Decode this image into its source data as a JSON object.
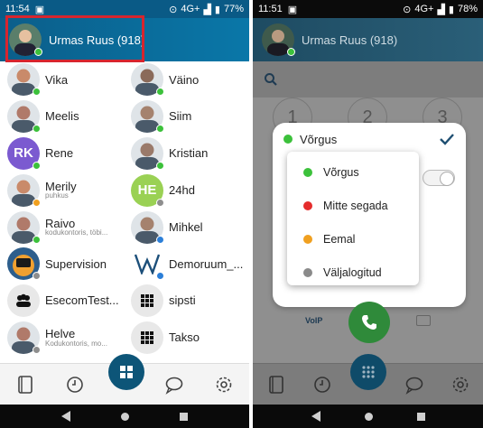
{
  "left": {
    "status": {
      "time": "11:54",
      "network": "4G+",
      "battery": "77%"
    },
    "header": {
      "user_name": "Urmas Ruus (918)"
    },
    "contacts": [
      {
        "name": "Vika",
        "sub": "",
        "status": "green"
      },
      {
        "name": "Väino",
        "sub": "",
        "status": "green"
      },
      {
        "name": "Meelis",
        "sub": "",
        "status": "green"
      },
      {
        "name": "Siim",
        "sub": "",
        "status": "green"
      },
      {
        "name": "Rene",
        "sub": "",
        "status": "green",
        "initials": "RK",
        "color": "#7b5ad0"
      },
      {
        "name": "Kristian",
        "sub": "",
        "status": "green"
      },
      {
        "name": "Merily",
        "sub": "puhkus",
        "status": "orange"
      },
      {
        "name": "24hd",
        "sub": "",
        "status": "gray",
        "initials": "HE",
        "color": "#9ad154"
      },
      {
        "name": "Raivo",
        "sub": "kodukontoris, töbi...",
        "status": "green"
      },
      {
        "name": "Mihkel",
        "sub": "",
        "status": "blue"
      },
      {
        "name": "Supervision",
        "sub": "",
        "status": "gray"
      },
      {
        "name": "Demoruum_...",
        "sub": "",
        "status": "blue"
      },
      {
        "name": "EsecomTest...",
        "sub": "",
        "status": ""
      },
      {
        "name": "sipsti",
        "sub": "",
        "status": ""
      },
      {
        "name": "Helve",
        "sub": "Kodukontoris, mo...",
        "status": "gray"
      },
      {
        "name": "Takso",
        "sub": "",
        "status": ""
      }
    ]
  },
  "right": {
    "status": {
      "time": "11:51",
      "network": "4G+",
      "battery": "78%"
    },
    "header": {
      "user_name": "Urmas Ruus (918)"
    },
    "keys": [
      "1",
      "2",
      "3"
    ],
    "panel": {
      "current_status": "Võrgus"
    },
    "options": [
      {
        "label": "Võrgus",
        "color": "#3cc13b"
      },
      {
        "label": "Mitte segada",
        "color": "#e52c2c"
      },
      {
        "label": "Eemal",
        "color": "#f0a020"
      },
      {
        "label": "Väljalogitud",
        "color": "#8a8a8a"
      }
    ],
    "voip_label": "VoIP"
  }
}
